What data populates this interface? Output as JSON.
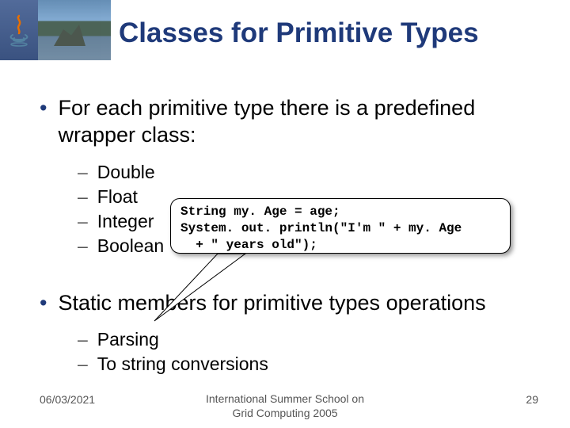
{
  "title": "Classes for Primitive Types",
  "bullet1": {
    "text": "For each primitive type there is a predefined wrapper class:",
    "items": [
      "Double",
      "Float",
      "Integer",
      "Boolean"
    ]
  },
  "bullet2": {
    "text": "Static members for primitive types operations",
    "items": [
      "Parsing",
      "To string conversions"
    ]
  },
  "callout_code": "String my. Age = age;\nSystem. out. println(\"I'm \" + my. Age\n  + \" years old\");",
  "footer": {
    "date": "06/03/2021",
    "venue_line1": "International Summer School on",
    "venue_line2": "Grid Computing 2005",
    "page": "29"
  }
}
